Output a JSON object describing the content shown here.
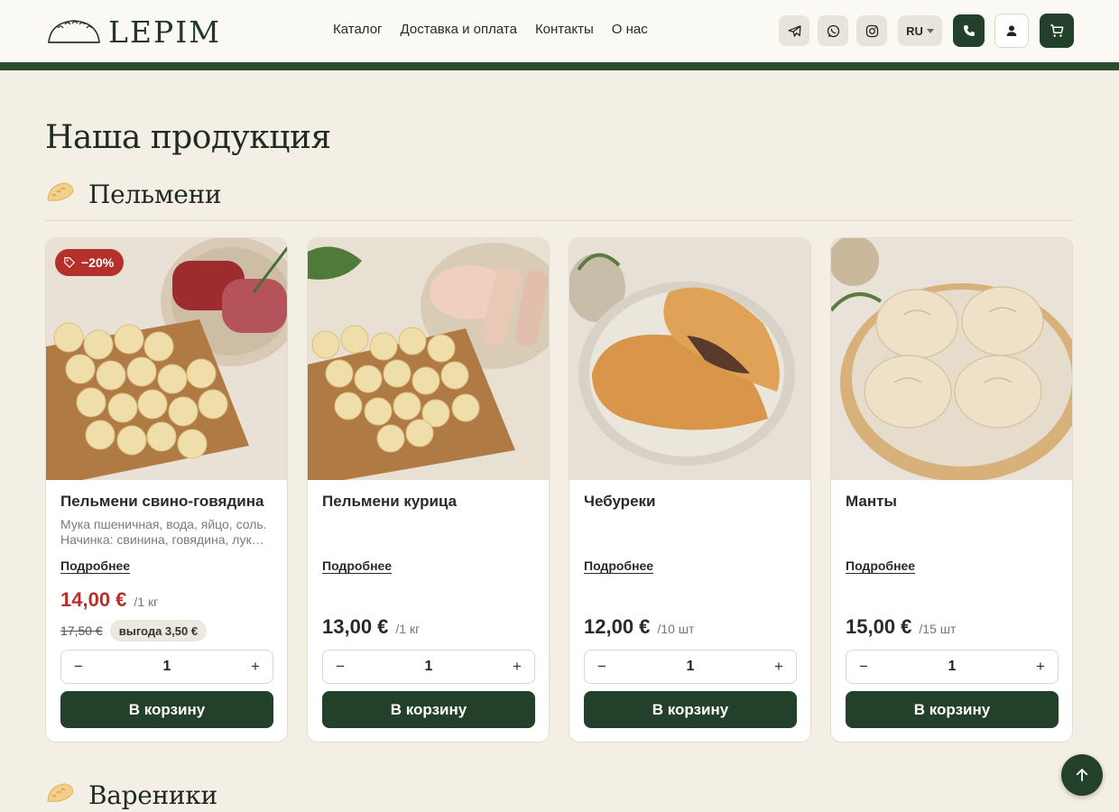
{
  "brand": {
    "logo_text": "LEPIM"
  },
  "nav": {
    "items": [
      "Каталог",
      "Доставка и оплата",
      "Контакты",
      "О нас"
    ]
  },
  "header": {
    "lang": "RU",
    "icons": [
      "telegram-icon",
      "whatsapp-icon",
      "instagram-icon",
      "phone-icon",
      "user-icon",
      "cart-icon"
    ]
  },
  "page": {
    "title": "Наша продукция"
  },
  "sections": [
    {
      "title": "Пельмени",
      "icon": "dumpling-icon"
    },
    {
      "title": "Вареники",
      "icon": "dumpling-icon"
    }
  ],
  "products": [
    {
      "name": "Пельмени свино-говядина",
      "desc": [
        "Мука пшеничная, вода, яйцо, соль.",
        "Начинка: свинина, говядина, лук…"
      ],
      "more": "Подробнее",
      "price": "14,00 €",
      "unit": "/1 кг",
      "old_price": "17,50 €",
      "saving": "выгода 3,50 €",
      "badge": "−20%",
      "qty": "1",
      "cta": "В корзину"
    },
    {
      "name": "Пельмени курица",
      "more": "Подробнее",
      "price": "13,00 €",
      "unit": "/1 кг",
      "qty": "1",
      "cta": "В корзину"
    },
    {
      "name": "Чебуреки",
      "more": "Подробнее",
      "price": "12,00 €",
      "unit": "/10 шт",
      "qty": "1",
      "cta": "В корзину"
    },
    {
      "name": "Манты",
      "more": "Подробнее",
      "price": "15,00 €",
      "unit": "/15 шт",
      "qty": "1",
      "cta": "В корзину"
    }
  ],
  "colors": {
    "accent": "#22402a",
    "sale": "#b6302b",
    "background": "#f4efe4"
  }
}
